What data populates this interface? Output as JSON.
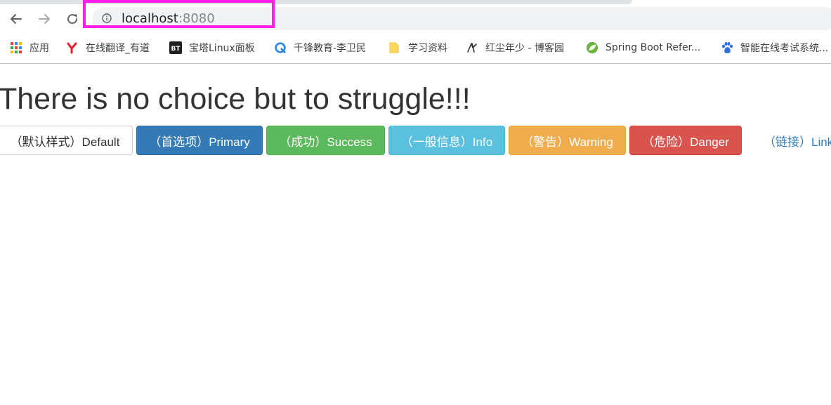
{
  "browser": {
    "url_host": "localhost",
    "url_port": ":8080",
    "bookmarks": [
      {
        "label": "应用",
        "icon": "apps-grid-icon"
      },
      {
        "label": "在线翻译_有道",
        "icon": "youdao-icon"
      },
      {
        "label": "宝塔Linux面板",
        "icon": "bt-icon"
      },
      {
        "label": "千锋教育-李卫民",
        "icon": "qianfeng-icon"
      },
      {
        "label": "学习资料",
        "icon": "folder-icon"
      },
      {
        "label": "红尘年少 - 博客园",
        "icon": "cnblogs-icon"
      },
      {
        "label": "Spring Boot Refer...",
        "icon": "spring-icon"
      },
      {
        "label": "智能在线考试系统...",
        "icon": "baidu-paw-icon"
      }
    ]
  },
  "page": {
    "headline": "There is no choice but to struggle!!!",
    "buttons": {
      "default": "（默认样式）Default",
      "primary": "（首选项）Primary",
      "success": "（成功）Success",
      "info": "（一般信息）Info",
      "warning": "（警告）Warning",
      "danger": "（危险）Danger",
      "link": "（链接）Link"
    }
  },
  "colors": {
    "highlight": "#ff1fe6",
    "primary": "#337ab7",
    "success": "#5cb85c",
    "info": "#5bc0de",
    "warning": "#f0ad4e",
    "danger": "#d9534f"
  }
}
